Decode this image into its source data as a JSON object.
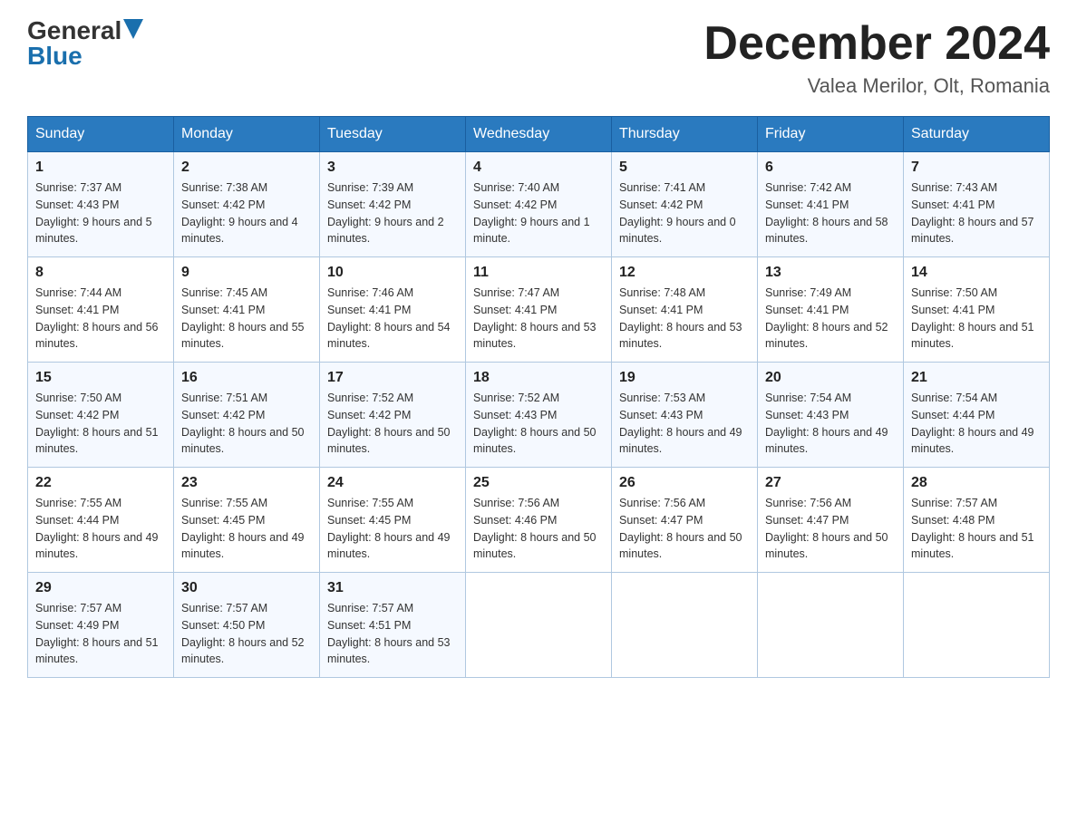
{
  "logo": {
    "general": "General",
    "blue": "Blue"
  },
  "title": "December 2024",
  "subtitle": "Valea Merilor, Olt, Romania",
  "days_of_week": [
    "Sunday",
    "Monday",
    "Tuesday",
    "Wednesday",
    "Thursday",
    "Friday",
    "Saturday"
  ],
  "weeks": [
    [
      {
        "day": "1",
        "sunrise": "7:37 AM",
        "sunset": "4:43 PM",
        "daylight": "9 hours and 5 minutes."
      },
      {
        "day": "2",
        "sunrise": "7:38 AM",
        "sunset": "4:42 PM",
        "daylight": "9 hours and 4 minutes."
      },
      {
        "day": "3",
        "sunrise": "7:39 AM",
        "sunset": "4:42 PM",
        "daylight": "9 hours and 2 minutes."
      },
      {
        "day": "4",
        "sunrise": "7:40 AM",
        "sunset": "4:42 PM",
        "daylight": "9 hours and 1 minute."
      },
      {
        "day": "5",
        "sunrise": "7:41 AM",
        "sunset": "4:42 PM",
        "daylight": "9 hours and 0 minutes."
      },
      {
        "day": "6",
        "sunrise": "7:42 AM",
        "sunset": "4:41 PM",
        "daylight": "8 hours and 58 minutes."
      },
      {
        "day": "7",
        "sunrise": "7:43 AM",
        "sunset": "4:41 PM",
        "daylight": "8 hours and 57 minutes."
      }
    ],
    [
      {
        "day": "8",
        "sunrise": "7:44 AM",
        "sunset": "4:41 PM",
        "daylight": "8 hours and 56 minutes."
      },
      {
        "day": "9",
        "sunrise": "7:45 AM",
        "sunset": "4:41 PM",
        "daylight": "8 hours and 55 minutes."
      },
      {
        "day": "10",
        "sunrise": "7:46 AM",
        "sunset": "4:41 PM",
        "daylight": "8 hours and 54 minutes."
      },
      {
        "day": "11",
        "sunrise": "7:47 AM",
        "sunset": "4:41 PM",
        "daylight": "8 hours and 53 minutes."
      },
      {
        "day": "12",
        "sunrise": "7:48 AM",
        "sunset": "4:41 PM",
        "daylight": "8 hours and 53 minutes."
      },
      {
        "day": "13",
        "sunrise": "7:49 AM",
        "sunset": "4:41 PM",
        "daylight": "8 hours and 52 minutes."
      },
      {
        "day": "14",
        "sunrise": "7:50 AM",
        "sunset": "4:41 PM",
        "daylight": "8 hours and 51 minutes."
      }
    ],
    [
      {
        "day": "15",
        "sunrise": "7:50 AM",
        "sunset": "4:42 PM",
        "daylight": "8 hours and 51 minutes."
      },
      {
        "day": "16",
        "sunrise": "7:51 AM",
        "sunset": "4:42 PM",
        "daylight": "8 hours and 50 minutes."
      },
      {
        "day": "17",
        "sunrise": "7:52 AM",
        "sunset": "4:42 PM",
        "daylight": "8 hours and 50 minutes."
      },
      {
        "day": "18",
        "sunrise": "7:52 AM",
        "sunset": "4:43 PM",
        "daylight": "8 hours and 50 minutes."
      },
      {
        "day": "19",
        "sunrise": "7:53 AM",
        "sunset": "4:43 PM",
        "daylight": "8 hours and 49 minutes."
      },
      {
        "day": "20",
        "sunrise": "7:54 AM",
        "sunset": "4:43 PM",
        "daylight": "8 hours and 49 minutes."
      },
      {
        "day": "21",
        "sunrise": "7:54 AM",
        "sunset": "4:44 PM",
        "daylight": "8 hours and 49 minutes."
      }
    ],
    [
      {
        "day": "22",
        "sunrise": "7:55 AM",
        "sunset": "4:44 PM",
        "daylight": "8 hours and 49 minutes."
      },
      {
        "day": "23",
        "sunrise": "7:55 AM",
        "sunset": "4:45 PM",
        "daylight": "8 hours and 49 minutes."
      },
      {
        "day": "24",
        "sunrise": "7:55 AM",
        "sunset": "4:45 PM",
        "daylight": "8 hours and 49 minutes."
      },
      {
        "day": "25",
        "sunrise": "7:56 AM",
        "sunset": "4:46 PM",
        "daylight": "8 hours and 50 minutes."
      },
      {
        "day": "26",
        "sunrise": "7:56 AM",
        "sunset": "4:47 PM",
        "daylight": "8 hours and 50 minutes."
      },
      {
        "day": "27",
        "sunrise": "7:56 AM",
        "sunset": "4:47 PM",
        "daylight": "8 hours and 50 minutes."
      },
      {
        "day": "28",
        "sunrise": "7:57 AM",
        "sunset": "4:48 PM",
        "daylight": "8 hours and 51 minutes."
      }
    ],
    [
      {
        "day": "29",
        "sunrise": "7:57 AM",
        "sunset": "4:49 PM",
        "daylight": "8 hours and 51 minutes."
      },
      {
        "day": "30",
        "sunrise": "7:57 AM",
        "sunset": "4:50 PM",
        "daylight": "8 hours and 52 minutes."
      },
      {
        "day": "31",
        "sunrise": "7:57 AM",
        "sunset": "4:51 PM",
        "daylight": "8 hours and 53 minutes."
      },
      null,
      null,
      null,
      null
    ]
  ],
  "labels": {
    "sunrise": "Sunrise:",
    "sunset": "Sunset:",
    "daylight": "Daylight:"
  }
}
